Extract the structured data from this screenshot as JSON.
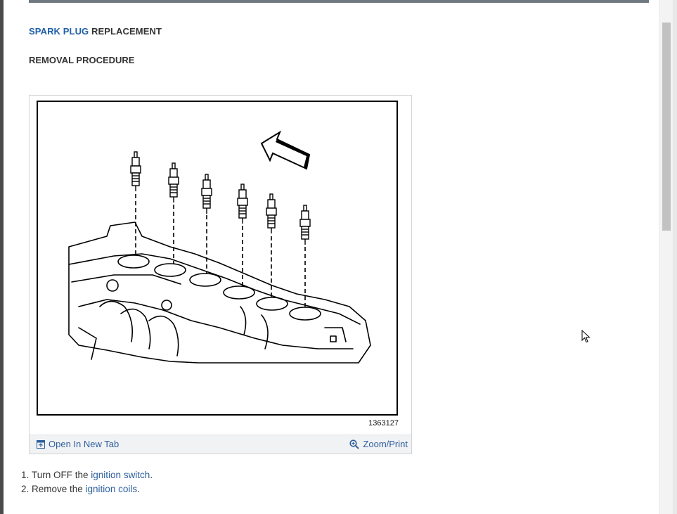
{
  "header": {
    "title_link": "SPARK PLUG",
    "title_rest": " REPLACEMENT"
  },
  "section": {
    "title": "REMOVAL PROCEDURE"
  },
  "figure": {
    "number": "1363127",
    "open_label": "Open In New Tab",
    "zoom_label": "Zoom/Print"
  },
  "steps": [
    {
      "number": "1.",
      "text_before": "Turn OFF the ",
      "link": "ignition switch",
      "text_after": "."
    },
    {
      "number": "2.",
      "text_before": "Remove the ",
      "link": "ignition coils",
      "text_after": "."
    }
  ],
  "colors": {
    "link": "#2c5f9e",
    "title_link": "#1f5fa8",
    "text": "#333333",
    "toolbar_bg": "#f1f2f4"
  }
}
